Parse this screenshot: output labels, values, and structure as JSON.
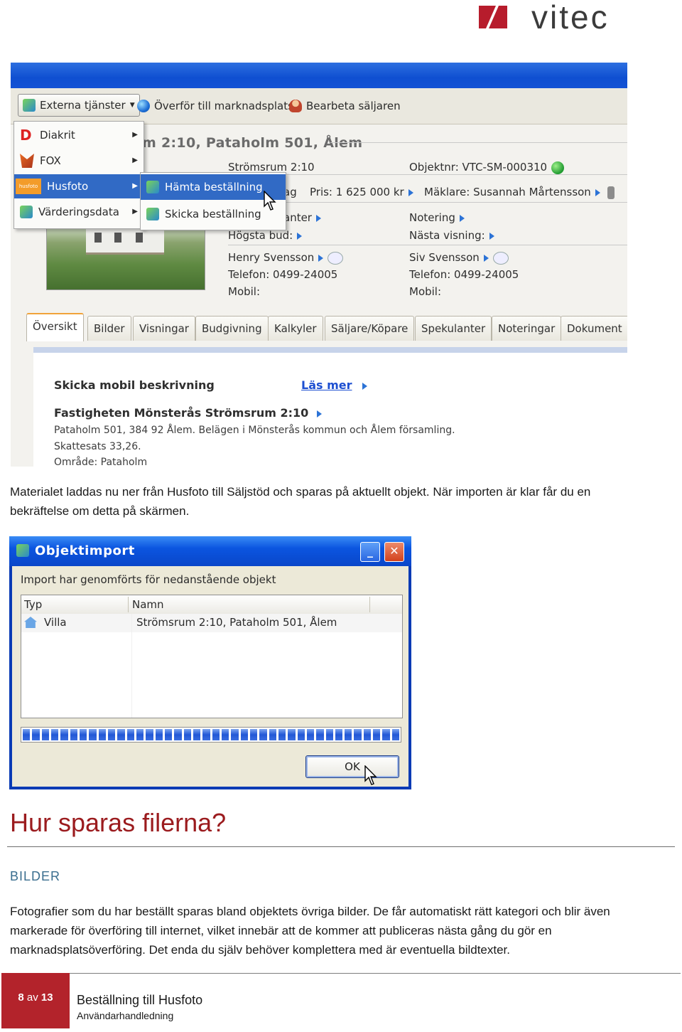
{
  "header": {
    "logo_text": "vitec"
  },
  "screenshot1": {
    "toolbar": {
      "external_services": "Externa tjänster",
      "transfer": "Överför till marknadsplats",
      "edit_sellers": "Bearbeta säljaren"
    },
    "menu": {
      "items": [
        "Diakrit",
        "FOX",
        "Husfoto",
        "Värderingsdata"
      ],
      "husfoto_badge": "husfoto",
      "submenu": [
        "Hämta beställning",
        "Skicka beställning"
      ]
    },
    "object_title": "m 2:10, Pataholm 501, Ålem",
    "details": {
      "address": "Strömsrum 2:10",
      "object_no": "Objektnr: VTC-SM-000310",
      "price_partial": "ag",
      "price": "Pris: 1 625 000 kr",
      "broker": "Mäklare: Susannah Mårtensson",
      "interested_partial": "anter",
      "note": "Notering",
      "highest_bid": "Högsta bud:",
      "next_viewing": "Nästa visning:",
      "seller_name": "Henry Svensson",
      "seller_phone": "Telefon: 0499-24005",
      "seller_mobile": "Mobil:",
      "buyer_name": "Siv Svensson",
      "buyer_phone": "Telefon: 0499-24005",
      "buyer_mobile": "Mobil:"
    },
    "tabs": [
      "Översikt",
      "Bilder",
      "Visningar",
      "Budgivning",
      "Kalkyler",
      "Säljare/Köpare",
      "Spekulanter",
      "Noteringar",
      "Dokument"
    ],
    "panel": {
      "send_mobile": "Skicka mobil beskrivning",
      "read_more": "Läs mer",
      "property_title": "Fastigheten Mönsterås Strömsrum 2:10",
      "property_line1": "Pataholm 501, 384 92 Ålem. Belägen i Mönsterås kommun och Ålem församling.",
      "tax": "Skattesats 33,26.",
      "area": "Område: Pataholm"
    }
  },
  "paragraph1": {
    "line1": "Materialet laddas nu ner från Husfoto till Säljstöd och sparas på aktuellt objekt. När importen är klar får du en",
    "line2": "bekräftelse om detta på skärmen."
  },
  "dialog": {
    "title": "Objektimport",
    "message": "Import har genomförts för nedanstående objekt",
    "columns": [
      "Typ",
      "Namn"
    ],
    "rows": [
      {
        "type": "Villa",
        "name": "Strömsrum 2:10, Pataholm 501, Ålem"
      }
    ],
    "ok_label": "OK",
    "progress": 1.0
  },
  "section": {
    "heading": "Hur sparas filerna?",
    "subheading": "BILDER",
    "body_line1": "Fotografier som du har beställt sparas bland objektets övriga bilder. De får automatiskt rätt kategori och blir även",
    "body_line2": "markerade för överföring till internet, vilket innebär att de kommer att publiceras nästa gång du gör en",
    "body_line3": "marknadsplatsöverföring. Det enda du själv behöver komplettera med är eventuella bildtexter."
  },
  "footer": {
    "page_current": "8",
    "page_of": "av",
    "page_total": "13",
    "title": "Beställning till Husfoto",
    "subtitle": "Användarhandledning"
  },
  "colors": {
    "accent_red": "#9b1b1e",
    "footer_red": "#b3232b",
    "subheading_blue": "#3a6e8f",
    "xp_blue": "#0a46c9"
  }
}
